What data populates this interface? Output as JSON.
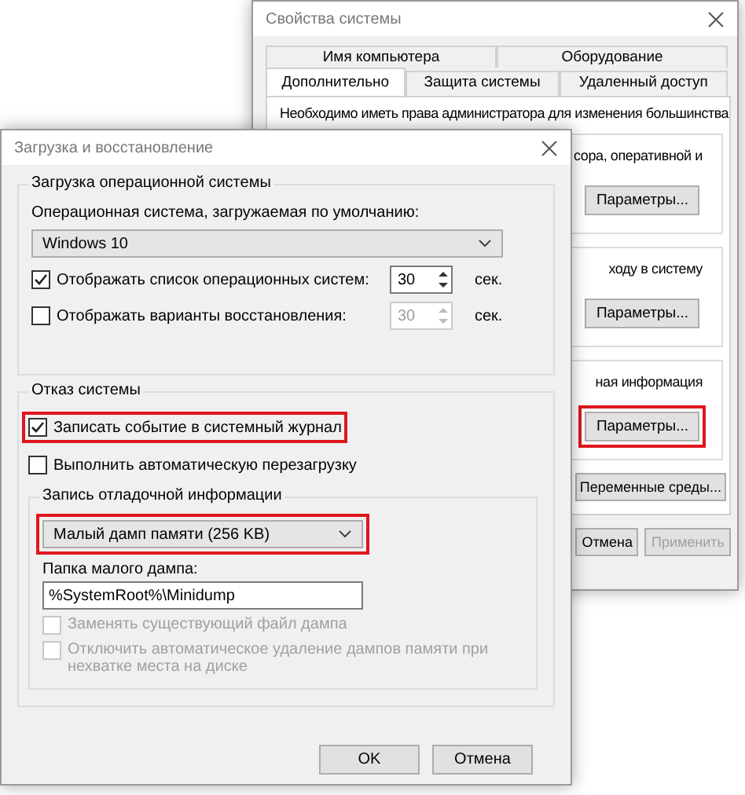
{
  "back_window": {
    "title": "Свойства системы",
    "tab_rows": [
      [
        {
          "label": "Имя компьютера",
          "selected": false
        },
        {
          "label": "Оборудование",
          "selected": false
        }
      ],
      [
        {
          "label": "Дополнительно",
          "selected": true
        },
        {
          "label": "Защита системы",
          "selected": false
        },
        {
          "label": "Удаленный доступ",
          "selected": false
        }
      ]
    ],
    "note": "Необходимо иметь права администратора для изменения большинства",
    "sections": [
      {
        "text": "сора, оперативной и",
        "button": {
          "label": "Параметры...",
          "highlighted": false
        }
      },
      {
        "text": "ходу в систему",
        "button": {
          "label": "Параметры...",
          "highlighted": false
        }
      },
      {
        "text": "ная информация",
        "button": {
          "label": "Параметры...",
          "highlighted": true
        }
      }
    ],
    "env_button": "Переменные среды...",
    "footer_buttons": [
      {
        "label": "Отмена",
        "disabled": false
      },
      {
        "label": "Применить",
        "disabled": true
      }
    ]
  },
  "front_window": {
    "title": "Загрузка и восстановление",
    "boot_group": {
      "title": "Загрузка операционной системы",
      "default_os_label": "Операционная система, загружаемая по умолчанию:",
      "default_os": "Windows 10",
      "options": [
        {
          "label": "Отображать список операционных систем:",
          "checked": true,
          "value": "30",
          "unit": "сек.",
          "disabled": false
        },
        {
          "label": "Отображать варианты восстановления:",
          "checked": false,
          "value": "30",
          "unit": "сек.",
          "disabled": true
        }
      ]
    },
    "failure_group": {
      "title": "Отказ системы",
      "options": [
        {
          "label": "Записать событие в системный журнал",
          "checked": true,
          "highlighted": true
        },
        {
          "label": "Выполнить автоматическую перезагрузку",
          "checked": false,
          "highlighted": false
        }
      ],
      "debug_group": {
        "title": "Запись отладочной информации",
        "dump_type": {
          "value": "Малый дамп памяти (256 KB)",
          "highlighted": true
        },
        "folder_label": "Папка малого дампа:",
        "folder_value": "%SystemRoot%\\Minidump",
        "options": [
          {
            "label": "Заменять существующий файл дампа",
            "checked": false,
            "disabled": true
          },
          {
            "label": "Отключить автоматическое удаление дампов памяти при нехватке места на диске",
            "checked": false,
            "disabled": true
          }
        ]
      }
    },
    "buttons": [
      "OK",
      "Отмена"
    ]
  }
}
